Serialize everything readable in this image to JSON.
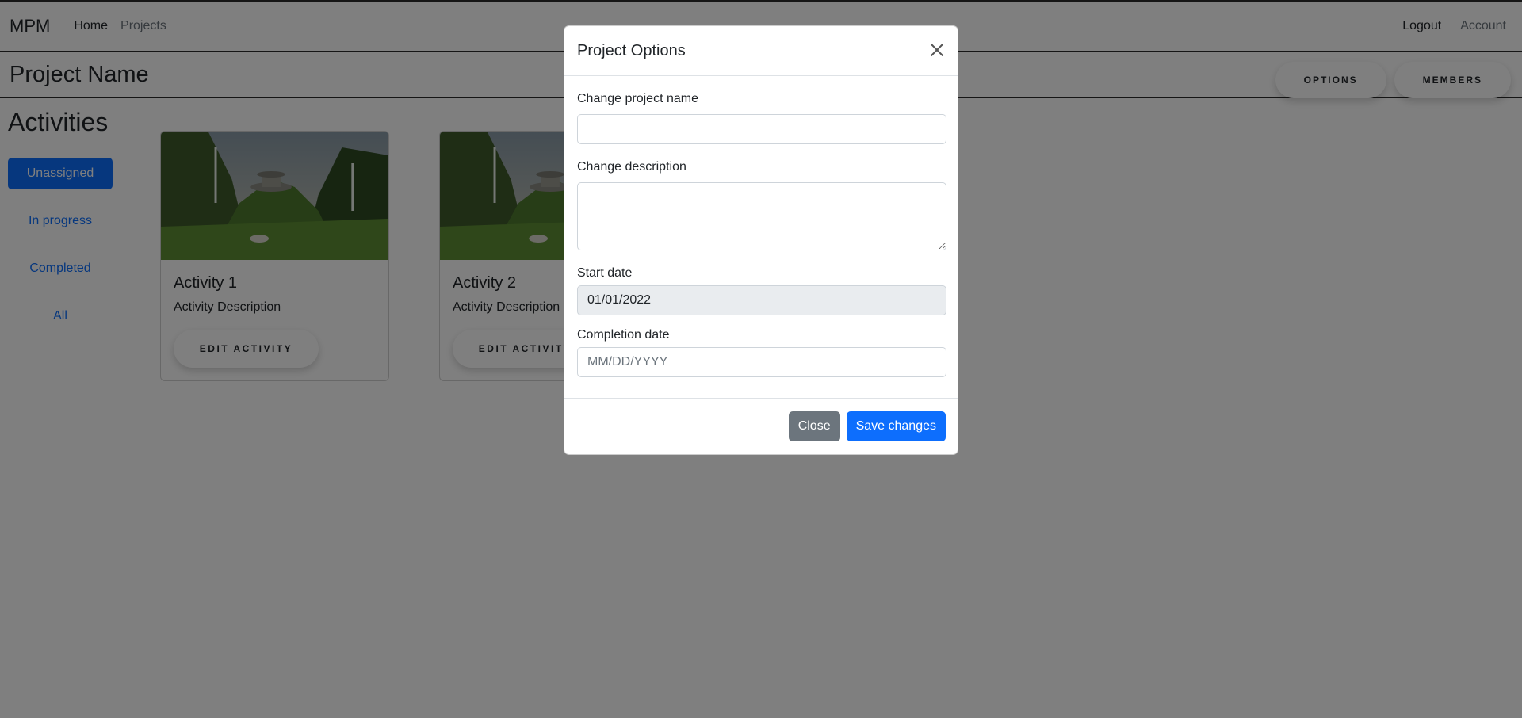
{
  "navbar": {
    "brand": "MPM",
    "links": [
      {
        "label": "Home"
      },
      {
        "label": "Projects"
      }
    ],
    "right_links": [
      {
        "label": "Logout"
      },
      {
        "label": "Account"
      }
    ]
  },
  "project": {
    "title": "Project Name",
    "options_label": "OPTIONS",
    "members_label": "MEMBERS"
  },
  "sidebar": {
    "title": "Activities",
    "items": [
      {
        "label": "Unassigned",
        "active": true
      },
      {
        "label": "In progress"
      },
      {
        "label": "Completed"
      },
      {
        "label": "All"
      }
    ]
  },
  "cards": [
    {
      "title": "Activity 1",
      "description": "Activity Description",
      "button": "EDIT ACTIVITY"
    },
    {
      "title": "Activity 2",
      "description": "Activity Description",
      "button": "EDIT ACTIVITY"
    }
  ],
  "modal": {
    "title": "Project Options",
    "fields": {
      "name_label": "Change project name",
      "name_value": "",
      "description_label": "Change description",
      "description_value": "",
      "start_label": "Start date",
      "start_value": "01/01/2022",
      "completion_label": "Completion date",
      "completion_placeholder": "MM/DD/YYYY"
    },
    "close_label": "Close",
    "save_label": "Save changes"
  },
  "colors": {
    "primary": "#0d6efd",
    "secondary": "#6c757d",
    "backdrop": "rgba(0,0,0,0.5)"
  }
}
